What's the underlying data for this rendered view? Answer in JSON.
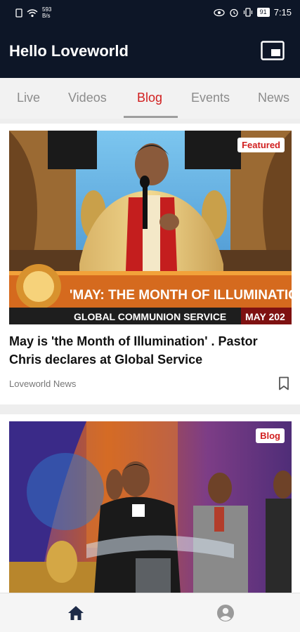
{
  "status_bar": {
    "network_speed_value": "593",
    "network_speed_unit": "B/s",
    "battery": "91",
    "time": "7:15"
  },
  "app_bar": {
    "title": "Hello Loveworld",
    "pip_icon": "picture-in-picture-icon"
  },
  "tabs": [
    {
      "label": "Live",
      "active": false
    },
    {
      "label": "Videos",
      "active": false
    },
    {
      "label": "Blog",
      "active": true
    },
    {
      "label": "Events",
      "active": false
    },
    {
      "label": "News",
      "active": false
    }
  ],
  "feed": [
    {
      "badge": "Featured",
      "banner_line_1": "'MAY: THE MONTH OF ILLUMINATION'",
      "banner_line_2": "GLOBAL COMMUNION SERVICE",
      "banner_date": "MAY 202",
      "headline": "May is 'the Month of Illumination' . Pastor Chris declares at Global Service",
      "source": "Loveworld News",
      "bookmark_icon": "bookmark-outline-icon"
    },
    {
      "badge": "Blog",
      "headline": "",
      "source": ""
    }
  ],
  "bottom_nav": {
    "home_icon": "home-icon",
    "profile_icon": "account-circle-icon"
  },
  "colors": {
    "app_bar": "#0d1627",
    "accent": "#d11f1f",
    "tab_inactive": "#8c8c8c"
  }
}
